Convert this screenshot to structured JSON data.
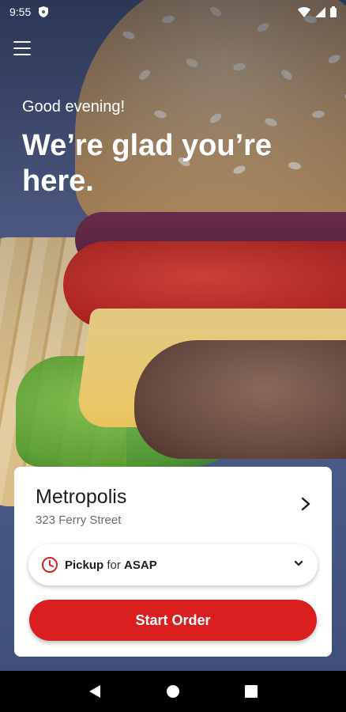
{
  "status_bar": {
    "time": "9:55"
  },
  "hero": {
    "greeting": "Good evening!",
    "headline": "We’re glad you’re here."
  },
  "store": {
    "name": "Metropolis",
    "address": "323 Ferry Street"
  },
  "order_mode": {
    "mode": "Pickup",
    "connector": "for",
    "timing": "ASAP"
  },
  "actions": {
    "start_order": "Start Order"
  },
  "colors": {
    "accent": "#d91f1f",
    "card_bg": "#ffffff",
    "text_primary": "#1c1c1c",
    "text_secondary": "#6a6a6a"
  },
  "icons": {
    "menu": "hamburger-menu-icon",
    "store_chevron": "chevron-right-icon",
    "pickup": "clock-icon",
    "dropdown": "chevron-down-icon",
    "nav_back": "back-triangle-icon",
    "nav_home": "home-circle-icon",
    "nav_recents": "recents-square-icon"
  }
}
